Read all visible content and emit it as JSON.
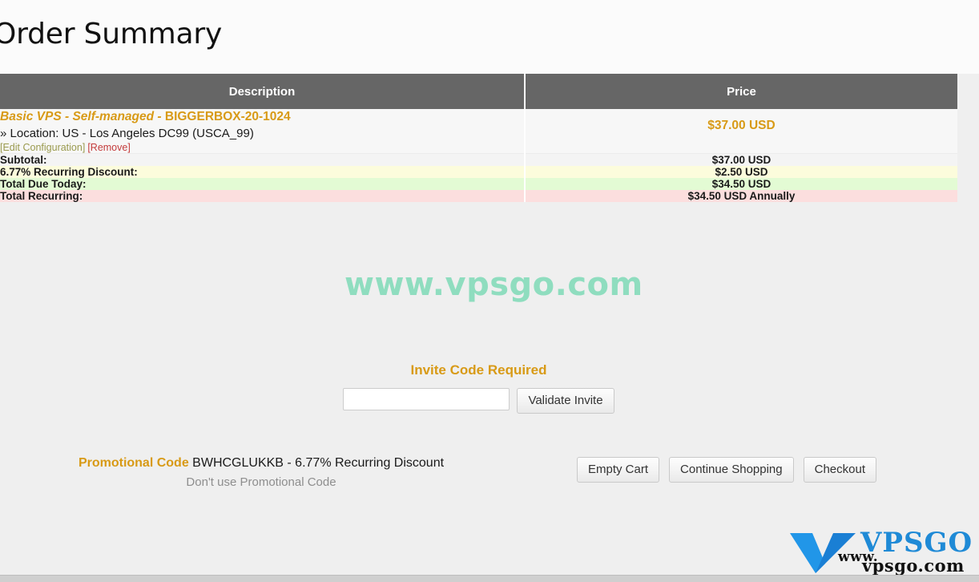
{
  "page": {
    "title": "Order Summary",
    "watermark": "www.vpsgo.com"
  },
  "table": {
    "headers": {
      "description": "Description",
      "price": "Price"
    },
    "item": {
      "name_italic": "Basic VPS - Self-managed - ",
      "name_code": "BIGGERBOX-20-1024",
      "location": "» Location: US - Los Angeles DC99 (USCA_99)",
      "price": "$37.00 USD",
      "edit_link": "[Edit Configuration]",
      "remove_link": "[Remove]"
    },
    "totals": [
      {
        "label": "Subtotal:",
        "value": "$37.00 USD"
      },
      {
        "label": "6.77% Recurring Discount:",
        "value": "$2.50 USD"
      },
      {
        "label": "Total Due Today:",
        "value": "$34.50 USD"
      },
      {
        "label": "Total Recurring:",
        "value": "$34.50 USD Annually"
      }
    ]
  },
  "invite": {
    "title": "Invite Code Required",
    "input_value": "",
    "input_placeholder": "",
    "validate_button": "Validate Invite"
  },
  "promo": {
    "label": "Promotional Code",
    "detail": " BWHCGLUKKB - 6.77% Recurring Discount",
    "remove_link": "Don't use Promotional Code"
  },
  "actions": {
    "empty_cart": "Empty Cart",
    "continue_shopping": "Continue Shopping",
    "checkout": "Checkout"
  },
  "logo": {
    "mark": "V",
    "word": "VPSGO",
    "www": "www.",
    "domain": "vpsgo.com"
  },
  "colors": {
    "accent_orange": "#d89a16",
    "header_grey": "#666666",
    "discount_row": "#fcfcdc",
    "due_today_row": "#e3fbd4",
    "recurring_row": "#fcdede",
    "remove_red": "#c43c3c",
    "watermark_teal": "#8fddbf",
    "logo_blue": "#1f8ad6"
  }
}
